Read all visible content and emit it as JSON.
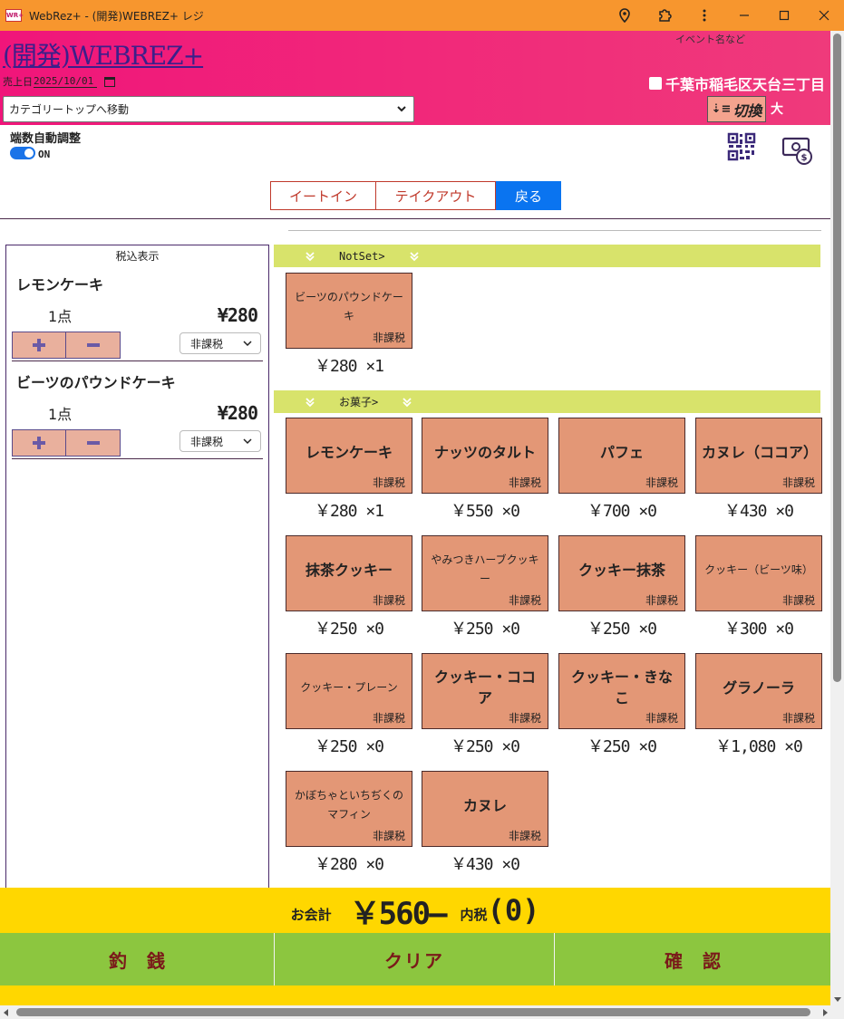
{
  "window": {
    "icon_text": "WR+",
    "title": "WebRez+ - (開発)WEBREZ+ レジ"
  },
  "header": {
    "app_title": "(開発)WEBREZ+",
    "event_hint": "イベント名など",
    "date_label": "売上日",
    "date_value": "2025/10/01",
    "location": "千葉市稲毛区天台三丁目",
    "category_select": "カテゴリートップへ移動",
    "switch_label": "切換",
    "size_label": "大"
  },
  "controls": {
    "auto_adjust_label": "端数自動調整",
    "toggle_state": "ON",
    "tabs": [
      {
        "label": "イートイン",
        "active": false
      },
      {
        "label": "テイクアウト",
        "active": false
      },
      {
        "label": "戻る",
        "active": true
      }
    ]
  },
  "cart": {
    "header": "税込表示",
    "items": [
      {
        "name": "レモンケーキ",
        "qty": "1点",
        "price": "¥280",
        "tax": "非課税"
      },
      {
        "name": "ビーツのパウンドケーキ",
        "qty": "1点",
        "price": "¥280",
        "tax": "非課税"
      }
    ]
  },
  "sections": [
    {
      "title": "NotSet>",
      "products": [
        {
          "name": "ビーツのパウンドケーキ",
          "tax": "非課税",
          "price": "￥280 ×1"
        }
      ]
    },
    {
      "title": "お菓子>",
      "products": [
        {
          "name": "レモンケーキ",
          "tax": "非課税",
          "price": "￥280 ×1"
        },
        {
          "name": "ナッツのタルト",
          "tax": "非課税",
          "price": "￥550 ×0"
        },
        {
          "name": "パフェ",
          "tax": "非課税",
          "price": "￥700 ×0"
        },
        {
          "name": "カヌレ（ココア）",
          "tax": "非課税",
          "price": "￥430 ×0"
        },
        {
          "name": "抹茶クッキー",
          "tax": "非課税",
          "price": "￥250 ×0"
        },
        {
          "name": "やみつきハーブクッキー",
          "tax": "非課税",
          "price": "￥250 ×0"
        },
        {
          "name": "クッキー抹茶",
          "tax": "非課税",
          "price": "￥250 ×0"
        },
        {
          "name": "クッキー（ビーツ味）",
          "tax": "非課税",
          "price": "￥300 ×0"
        },
        {
          "name": "クッキー・プレーン",
          "tax": "非課税",
          "price": "￥250 ×0"
        },
        {
          "name": "クッキー・ココア",
          "tax": "非課税",
          "price": "￥250 ×0"
        },
        {
          "name": "クッキー・きなこ",
          "tax": "非課税",
          "price": "￥250 ×0"
        },
        {
          "name": "グラノーラ",
          "tax": "非課税",
          "price": "￥1,080 ×0"
        },
        {
          "name": "かぼちゃといちぢくのマフィン",
          "tax": "非課税",
          "price": "￥280 ×0"
        },
        {
          "name": "カヌレ",
          "tax": "非課税",
          "price": "￥430 ×0"
        }
      ]
    }
  ],
  "footer": {
    "total_label": "お会計",
    "total_amount": "￥560–",
    "tax_label": "内税",
    "tax_amount": "(0)",
    "actions": [
      "釣銭",
      "クリア",
      "確認"
    ]
  },
  "colors": {
    "titlebar": "#f7962e",
    "header": "#f0157a",
    "product_tile": "#e39776",
    "section_bar": "#d8e36b",
    "total_bar": "#ffd700",
    "action_bar": "#8cc63f",
    "active_tab": "#0a74f0"
  },
  "icons": [
    "location-icon",
    "extension-icon",
    "more-vert-icon",
    "minimize-icon",
    "maximize-icon",
    "close-icon",
    "calendar-icon",
    "chevron-down-icon",
    "sort-icon",
    "qr-code-icon",
    "cash-icon",
    "plus-icon",
    "minus-icon",
    "double-chevron-down-icon"
  ]
}
